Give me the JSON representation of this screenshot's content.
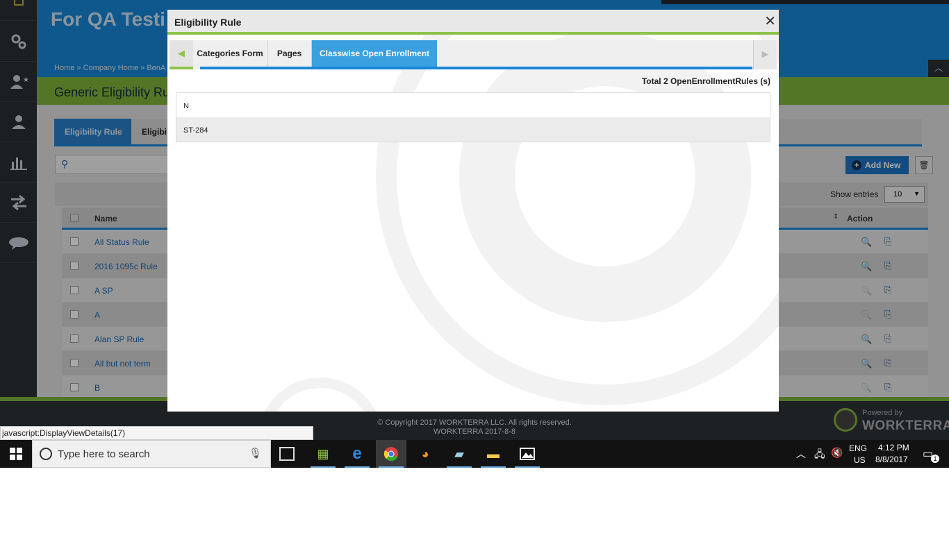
{
  "app": {
    "title": "For QA Testi",
    "breadcrumbs": [
      "Home",
      "Company Home",
      "BenA"
    ],
    "breadcrumb_sep": "»",
    "page_title": "Generic Eligibility Ru",
    "tabs": [
      "Eligibility Rule",
      "Eligibi"
    ],
    "add_new_label": "Add New",
    "show_entries_label": "Show entries",
    "entries_value": "10",
    "columns": {
      "name": "Name",
      "action": "Action"
    },
    "rows": [
      "All Status Rule",
      "2016 1095c Rule",
      "A SP",
      "A",
      "Alan SP Rule",
      "All but not term",
      "B"
    ],
    "accent_color": "#1886d8",
    "green_color": "#7fb23a"
  },
  "modal": {
    "title": "Eligibility Rule",
    "close_label": "✕",
    "tabs": [
      "Categories Form",
      "Pages",
      "Classwise Open Enrollment"
    ],
    "active_tab": "Classwise Open Enrollment",
    "total_label": "Total 2 OpenEnrollmentRules (s)",
    "rules": [
      "N",
      "ST-284"
    ]
  },
  "footer": {
    "copyright": "© Copyright 2017 WORKTERRA LLC. All rights reserved.",
    "version": "WORKTERRA 2017-8-8",
    "powered_by": "Powered by",
    "brand": "WORKTERRA"
  },
  "statusbar": {
    "text": "javascript:DisplayViewDetails(17)"
  },
  "taskbar": {
    "search_placeholder": "Type here to search",
    "apps": [
      "calculator-icon",
      "edge-icon",
      "chrome-icon",
      "firefox-icon",
      "notes-icon",
      "file-explorer-icon",
      "photos-icon"
    ],
    "language": "ENG",
    "region": "US",
    "time": "4:12 PM",
    "date": "8/8/2017",
    "notification_count": "1"
  }
}
